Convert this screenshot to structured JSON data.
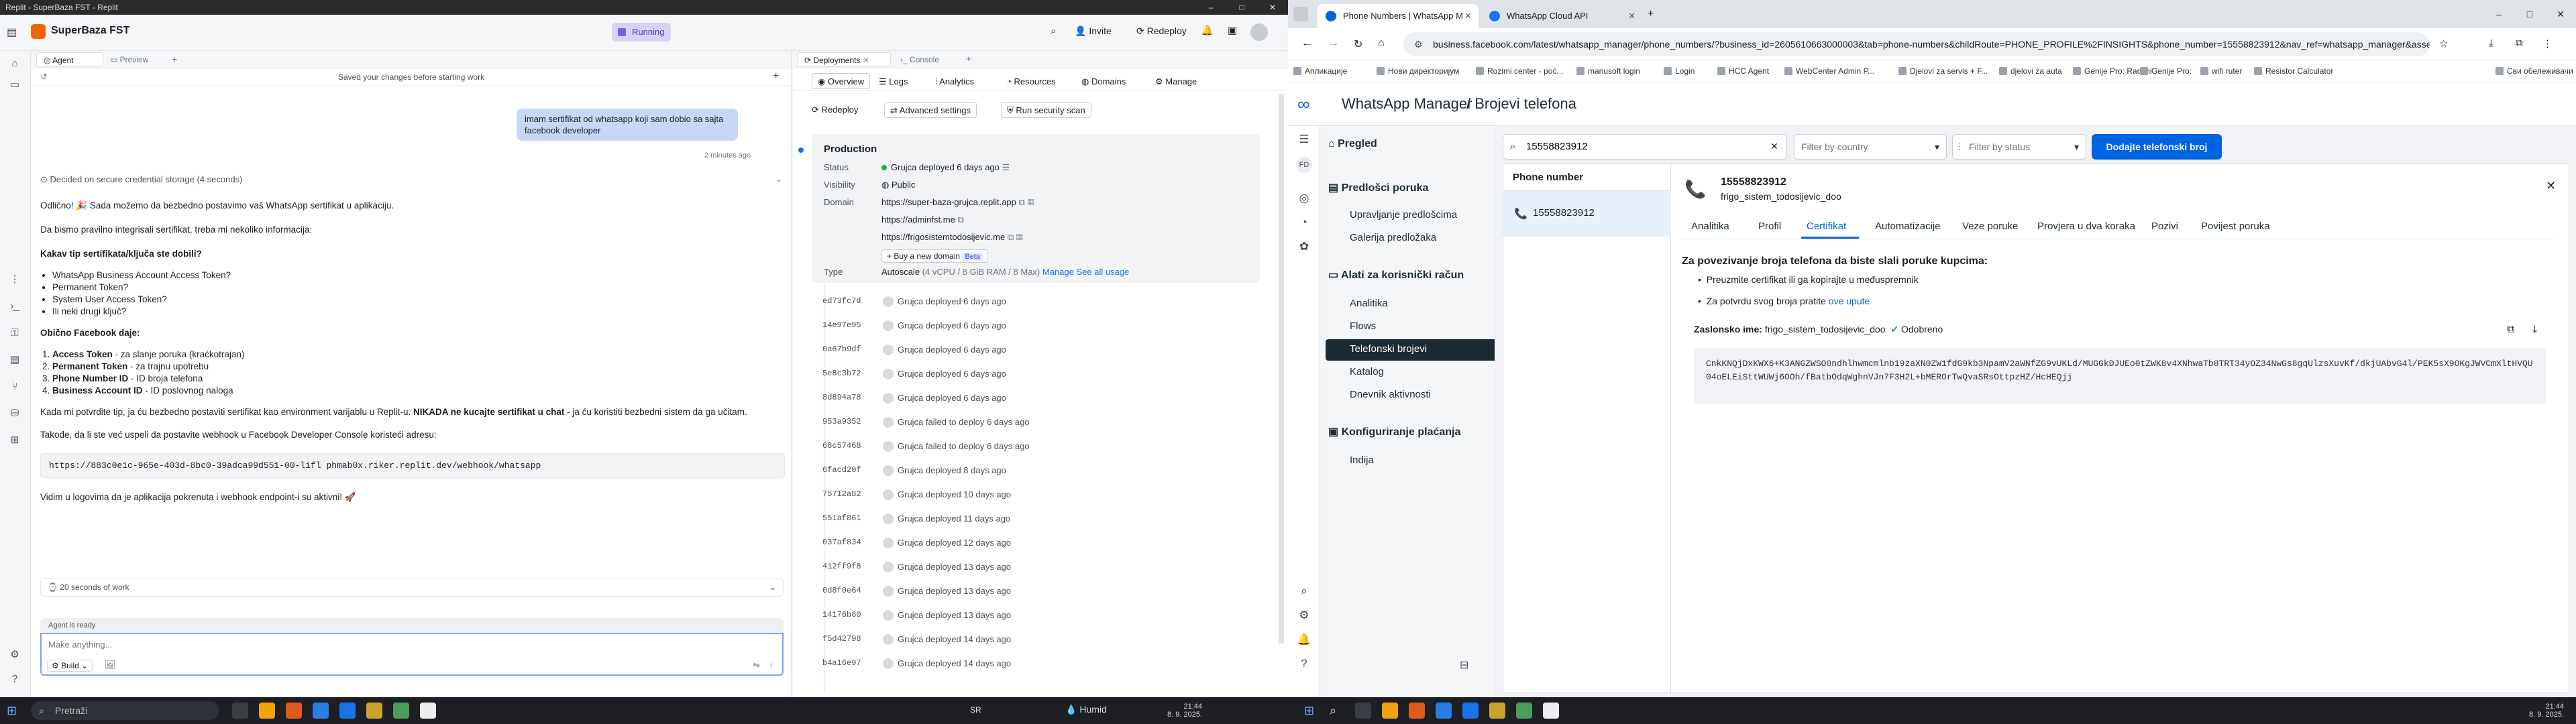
{
  "left": {
    "window_title": "Replit - SuperBaza FST - Replit",
    "app": {
      "project_name": "SuperBaza FST",
      "status": "Running",
      "invite": "Invite",
      "redeploy": "Redeploy"
    },
    "tabs": [
      "Agent",
      "Preview"
    ],
    "chat": {
      "saved_note": "Saved your changes before starting work",
      "user_message": "imam sertifikat od whatsapp koji sam dobio sa sajta facebook developer",
      "time_ago": "2 minutes ago",
      "decided": "Decided on secure credential storage (4 seconds)",
      "p1": "Odlično! 🎉 Sada možemo da bezbedno postavimo vaš WhatsApp sertifikat u aplikaciju.",
      "p2": "Da bismo pravilno integrisali sertifikat, treba mi nekoliko informacija:",
      "q_title": "Kakav tip sertifikata/ključa ste dobili?",
      "options": [
        "WhatsApp Business Account Access Token?",
        "Permanent Token?",
        "System User Access Token?",
        "Ili neki drugi ključ?"
      ],
      "usual": "Obično Facebook daje:",
      "usual_list": [
        {
          "b": "Access Token",
          "t": " - za slanje poruka (kraćkotrajan)"
        },
        {
          "b": "Permanent Token",
          "t": " - za trajnu upotrebu"
        },
        {
          "b": "Phone Number ID",
          "t": " - ID broja telefona"
        },
        {
          "b": "Business Account ID",
          "t": " - ID poslovnog naloga"
        }
      ],
      "confirm_pre": "Kada mi potvrdite tip, ja ću bezbedno postaviti sertifikat kao environment varijablu u Replit-u. ",
      "confirm_bold": "NIKADA ne kucajte sertifikat u chat",
      "confirm_post": " - ja ću koristiti bezbedni sistem da ga učitam.",
      "webhook_note": "Takođe, da li ste već uspeli da postavite webhook u Facebook Developer Console koristeći adresu:",
      "webhook_url": "https://883c0e1c-965e-403d-8bc0-39adca99d551-00-lifl phmab0x.riker.replit.dev/webhook/whatsapp",
      "logs_note": "Vidim u logovima da je aplikacija pokrenuta i webhook endpoint-i su aktivni! 🚀",
      "worked": "20 seconds of work",
      "agent_ready": "Agent is ready",
      "input_placeholder": "Make anything...",
      "build": "Build"
    },
    "deploy": {
      "tabs": [
        "Deployments",
        "Console"
      ],
      "subtabs": [
        "Overview",
        "Logs",
        "Analytics",
        "Resources",
        "Domains",
        "Manage"
      ],
      "actions": [
        "Redeploy",
        "Advanced settings",
        "Run security scan"
      ],
      "production": "Production",
      "status_label": "Status",
      "status_value": "Grujca deployed 6 days ago",
      "visibility_label": "Visibility",
      "visibility_value": "Public",
      "domain_label": "Domain",
      "domains": [
        "https://super-baza-grujca.replit.app",
        "https://adminfst.me",
        "https://frigosistemtodosijevic.me"
      ],
      "buy_domain": "Buy a new domain",
      "beta": "Beta",
      "type_label": "Type",
      "type_value": "Autoscale",
      "type_spec": "(4 vCPU / 8 GiB RAM / 8 Max)",
      "manage": "Manage",
      "see_usage": "See all usage",
      "rows": [
        {
          "hash": "ed73fc7d",
          "msg": "Grujca deployed 6 days ago"
        },
        {
          "hash": "14e97e95",
          "msg": "Grujca deployed 6 days ago"
        },
        {
          "hash": "0a67b9df",
          "msg": "Grujca deployed 6 days ago"
        },
        {
          "hash": "5e8c3b72",
          "msg": "Grujca deployed 6 days ago"
        },
        {
          "hash": "8d894a78",
          "msg": "Grujca deployed 6 days ago"
        },
        {
          "hash": "953a9352",
          "msg": "Grujca failed to deploy 6 days ago"
        },
        {
          "hash": "68c57468",
          "msg": "Grujca failed to deploy 6 days ago"
        },
        {
          "hash": "6facd20f",
          "msg": "Grujca deployed 8 days ago"
        },
        {
          "hash": "75712a82",
          "msg": "Grujca deployed 10 days ago"
        },
        {
          "hash": "551af861",
          "msg": "Grujca deployed 11 days ago"
        },
        {
          "hash": "037af834",
          "msg": "Grujca deployed 12 days ago"
        },
        {
          "hash": "412ff9f8",
          "msg": "Grujca deployed 13 days ago"
        },
        {
          "hash": "0d8f0e64",
          "msg": "Grujca deployed 13 days ago"
        },
        {
          "hash": "14176b80",
          "msg": "Grujca deployed 13 days ago"
        },
        {
          "hash": "f5d42798",
          "msg": "Grujca deployed 14 days ago"
        },
        {
          "hash": "b4a16e97",
          "msg": "Grujca deployed 14 days ago"
        }
      ]
    }
  },
  "right": {
    "browser_tabs": [
      "Phone Numbers | WhatsApp M",
      "WhatsApp Cloud API"
    ],
    "url": "business.facebook.com/latest/whatsapp_manager/phone_numbers/?business_id=2605610663000003&tab=phone-numbers&childRoute=PHONE_PROFILE%2FINSIGHTS&phone_number=15558823912&nav_ref=whatsapp_manager&asset_id=14616096...",
    "bookmarks": [
      "Апликације",
      "Нови директоријум",
      "Rozimi center - poć...",
      "manusoft login",
      "Login",
      "HCC Agent",
      "WebCenter Admin P...",
      "Djelovi za servis + F...",
      "djelovi za auta",
      "Genije Pro: Racuni",
      "Genije Pro:",
      "wifi ruter",
      "Resistor Calculator",
      "Сви обележивачи"
    ],
    "header": {
      "brand": "WhatsApp Manager",
      "page": "Brojevi telefona"
    },
    "nav": {
      "pregled": "Pregled",
      "predlosci": "Predlošci poruka",
      "upravljanje": "Upravljanje predlošcima",
      "galerija": "Galerija predložaka",
      "alati": "Alati za korisnički račun",
      "analitika": "Analitika",
      "flows": "Flows",
      "telefonski": "Telefonski brojevi",
      "katalog": "Katalog",
      "dnevnik": "Dnevnik aktivnosti",
      "konfig": "Konfiguriranje plaćanja",
      "indija": "Indija"
    },
    "search_value": "15558823912",
    "filter_country": "Filter by country",
    "filter_status": "Filter by status",
    "add_button": "Dodajte telefonski broj",
    "list_header": "Phone number",
    "list_number": "15558823912",
    "detail": {
      "number": "15558823912",
      "name": "frigo_sistem_todosijevic_doo",
      "tabs": [
        "Analitika",
        "Profil",
        "Certifikat",
        "Automatizacije",
        "Veze poruke",
        "Provjera u dva koraka",
        "Pozivi",
        "Povijest poruka"
      ],
      "active_tab": "Certifikat",
      "heading": "Za povezivanje broja telefona da biste slali poruke kupcima:",
      "b1": "Preuzmite certifikat ili ga kopirajte u međuspremnik",
      "b2_pre": "Za potvrdu svog broja pratite ",
      "b2_link": "ove upute",
      "display_label": "Zaslonsko ime:",
      "display_value": "frigo_sistem_todosijevic_doo",
      "approved": "Odobreno",
      "cert": "CnkKNQjDxKWX6+K3ANGZWSO0ndhlhwmcmlnb19zaXN0ZW1fdG9kb3NpamV2aWNfZG9vUKLd/MUGGkDJUEo0tZWK8v4XNhwaTb8TRT34yOZ34NwGs8gqUlzsXuvKf/dkjUAbvG4l/PEK5sX9OKgJWVCmXltHVQU04oELEiSttWUWj6OOh/fBatbOdqWghnVJn7F3H2L+bMEROrTwQvaSRsOttpzHZ/HcHEQjj"
    }
  },
  "taskbar": {
    "search": "Pretraži",
    "weather": "Humid",
    "time_left": "21:44",
    "date_left": "8. 9. 2025.",
    "time_right": "21:44",
    "date_right": "8. 9. 2025.",
    "lang": "SR"
  },
  "colors": {
    "replit_orange": "#f26207",
    "meta_blue": "#0064e0",
    "wa_green": "#1fa855",
    "dark_nav": "#1c2b33"
  }
}
